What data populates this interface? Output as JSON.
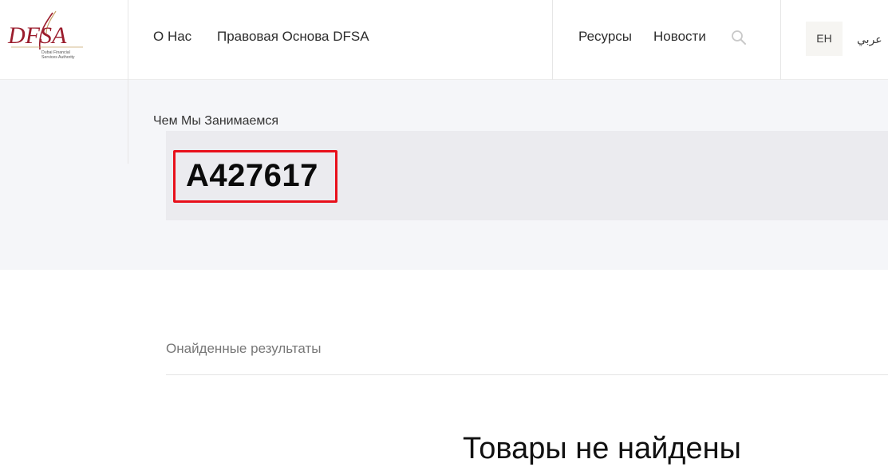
{
  "header": {
    "logo": {
      "icon": "dfsa-logo",
      "mark": "DFSA",
      "caption_line1": "Dubai Financial",
      "caption_line2": "Services Authority"
    },
    "nav_left": [
      {
        "label": "О Нас"
      },
      {
        "label": "Правовая Основа DFSA"
      }
    ],
    "nav_right": [
      {
        "label": "Ресурсы"
      },
      {
        "label": "Новости"
      }
    ],
    "search_icon": "search-icon",
    "lang_current": "EH",
    "lang_alt": "عربي"
  },
  "hero": {
    "section_label": "Чем Мы Занимаемся",
    "query": "A427617",
    "highlight_color": "#e8101b"
  },
  "results": {
    "count_label": "Онайденные результаты",
    "empty_message": "Товары не найдены"
  },
  "colors": {
    "brand": "#9b1c2c",
    "hero_bg": "#f5f6f9",
    "panel_bg": "#ebebef"
  }
}
